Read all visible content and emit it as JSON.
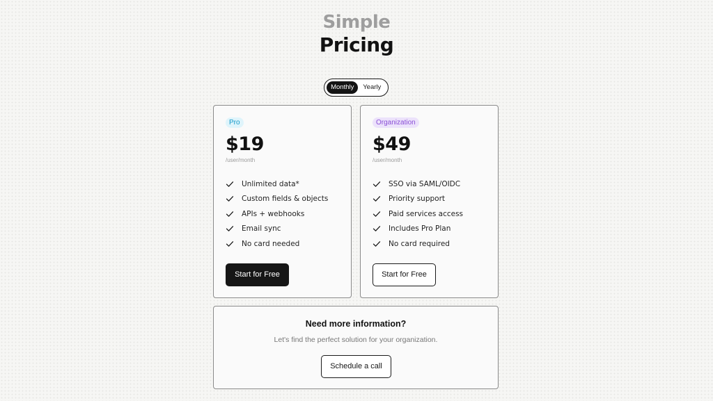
{
  "header": {
    "title_light": "Simple",
    "title_dark": "Pricing"
  },
  "billing_toggle": {
    "options": [
      "Monthly",
      "Yearly"
    ],
    "selected": "Monthly"
  },
  "plans": [
    {
      "badge": "Pro",
      "badge_color": "#1398c8",
      "price": "$19",
      "period": "/user/month",
      "features": [
        "Unlimited data*",
        "Custom fields & objects",
        "APIs + webhooks",
        "Email sync",
        "No card needed"
      ],
      "cta": "Start for Free",
      "cta_style": "dark"
    },
    {
      "badge": "Organization",
      "badge_color": "#8a4fd6",
      "price": "$49",
      "period": "/user/month",
      "features": [
        "SSO via SAML/OIDC",
        "Priority support",
        "Paid services access",
        "Includes Pro Plan",
        "No card required"
      ],
      "cta": "Start for Free",
      "cta_style": "light"
    }
  ],
  "contact": {
    "title": "Need more information?",
    "subtitle": "Let's find the perfect solution for your organization.",
    "cta": "Schedule a call"
  },
  "icons": {
    "feature_bullet": "check-icon"
  }
}
